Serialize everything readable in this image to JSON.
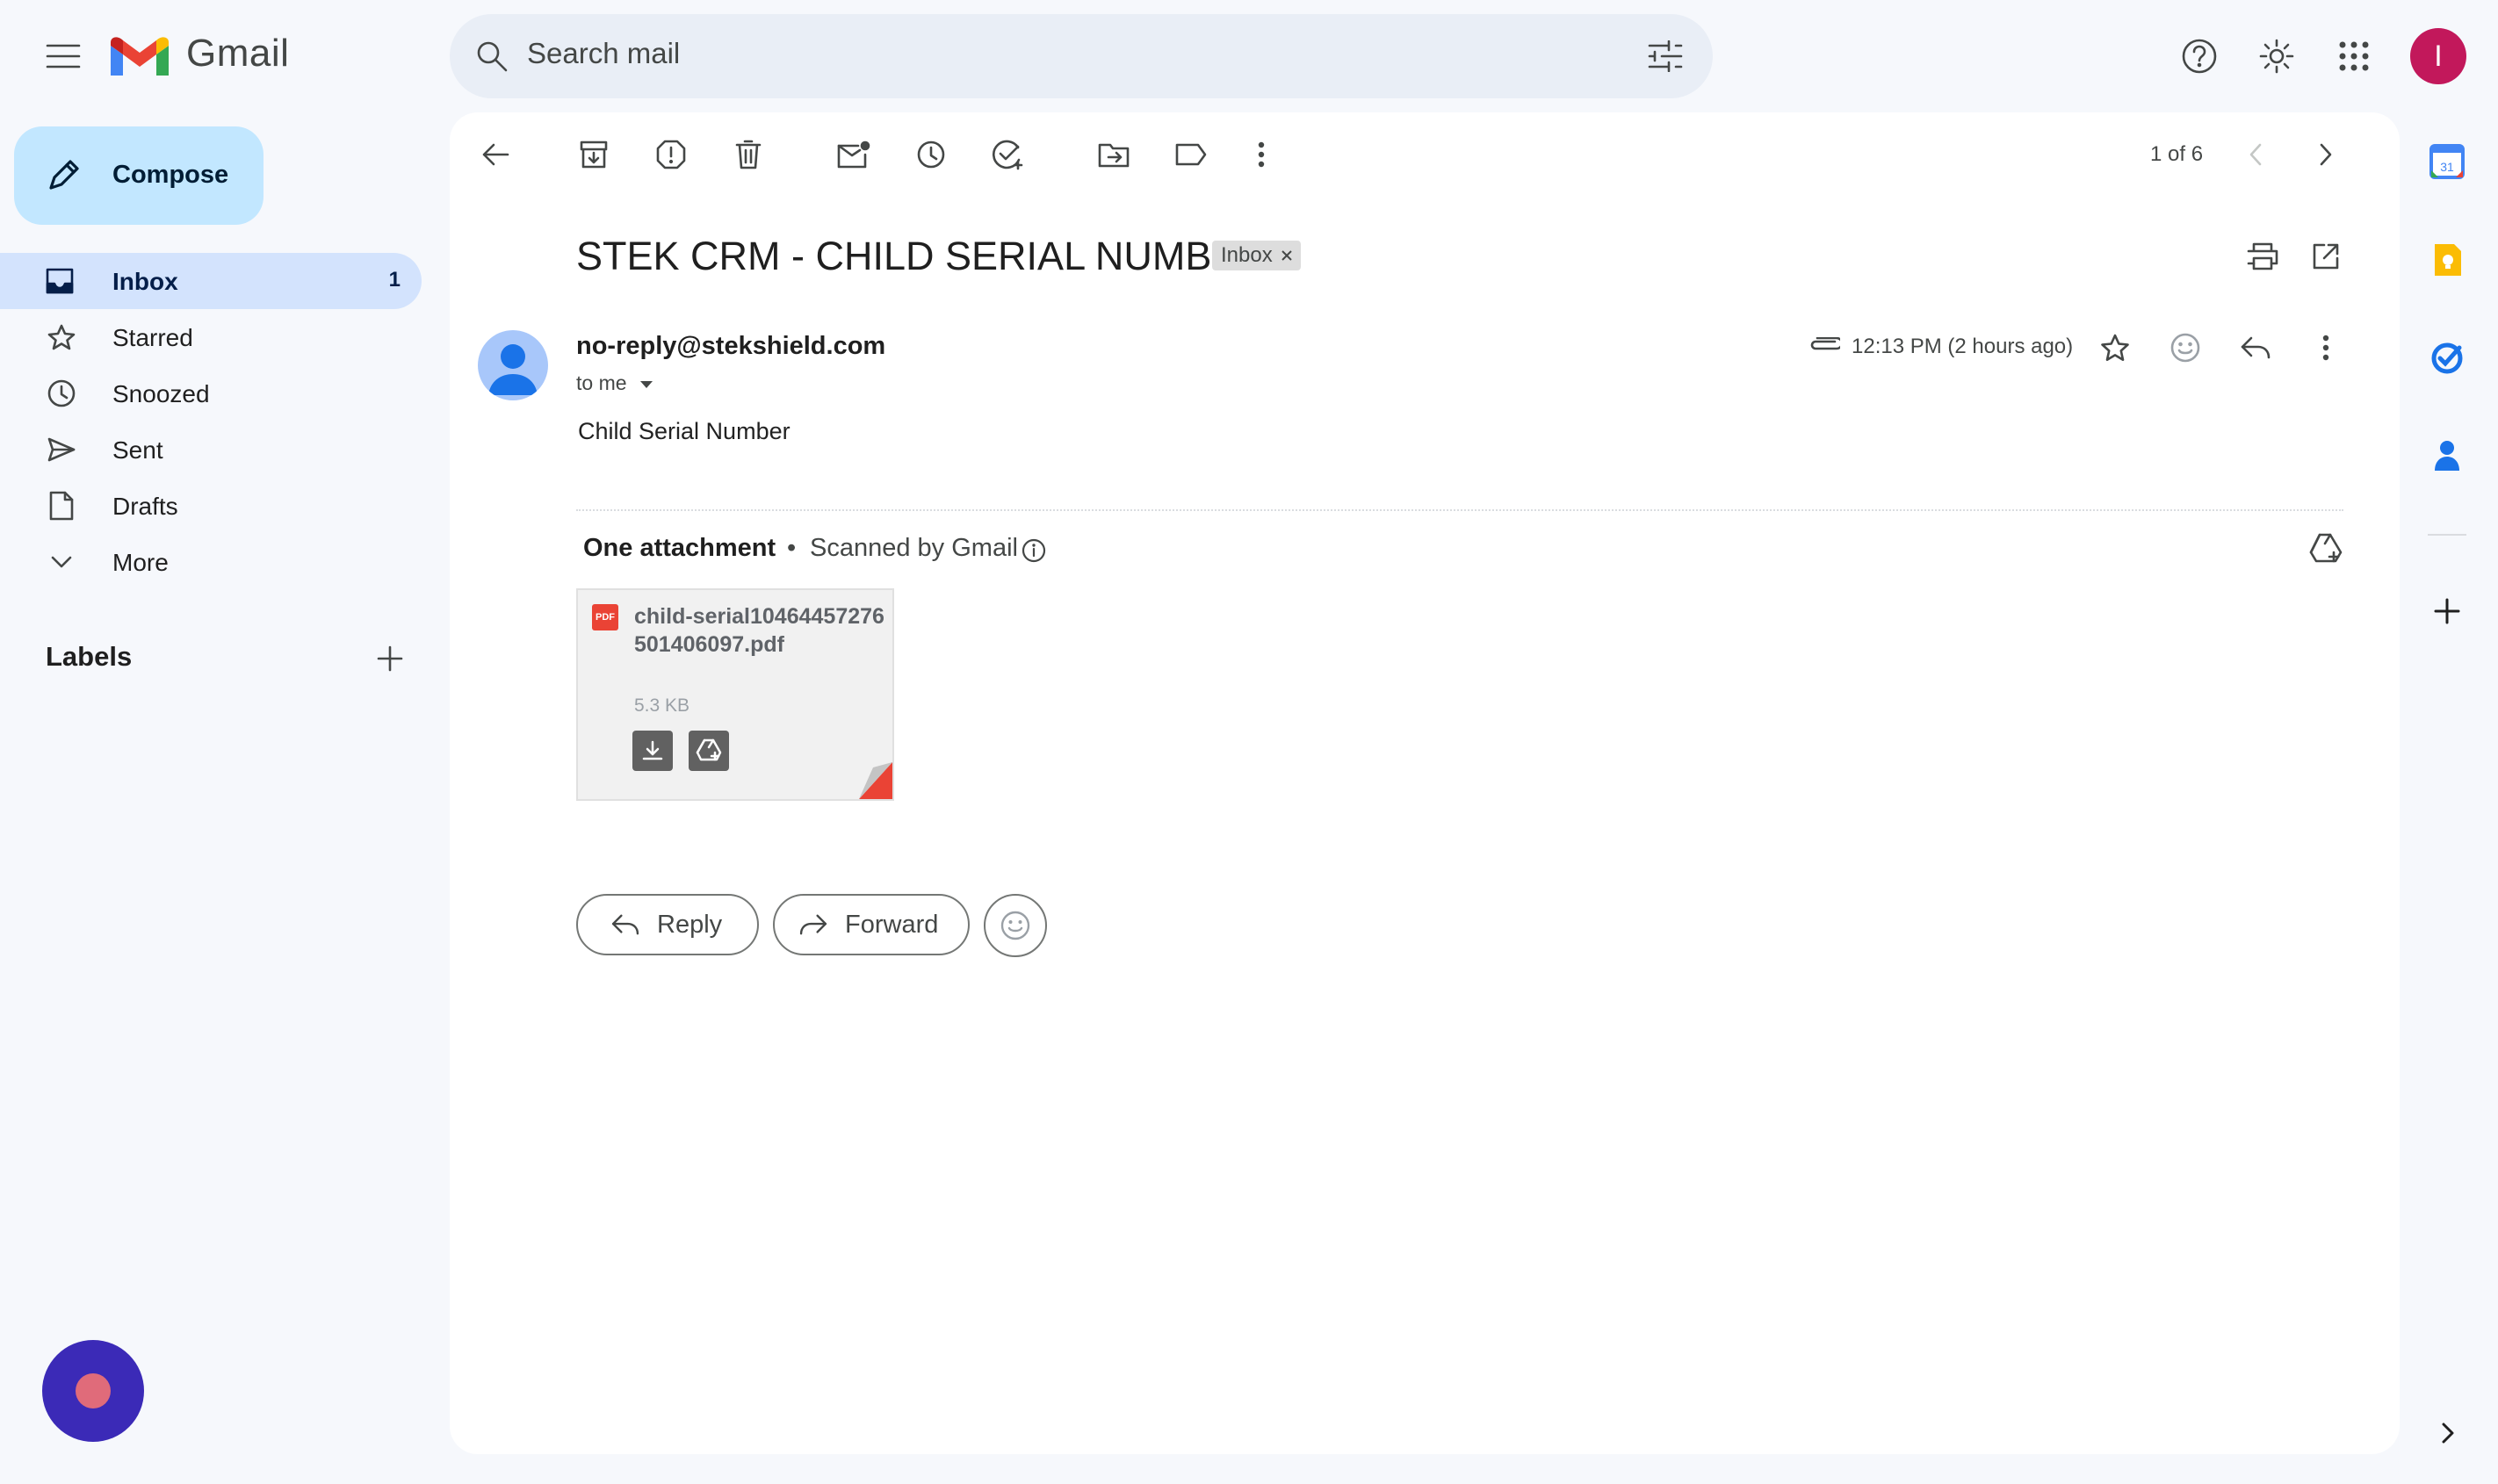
{
  "app": {
    "name": "Gmail",
    "account_initial": "I"
  },
  "search": {
    "placeholder": "Search mail"
  },
  "sidebar": {
    "compose_label": "Compose",
    "items": [
      {
        "label": "Inbox",
        "count": "1",
        "active": true,
        "icon": "inbox-icon"
      },
      {
        "label": "Starred",
        "count": "",
        "active": false,
        "icon": "star-icon"
      },
      {
        "label": "Snoozed",
        "count": "",
        "active": false,
        "icon": "clock-icon"
      },
      {
        "label": "Sent",
        "count": "",
        "active": false,
        "icon": "send-icon"
      },
      {
        "label": "Drafts",
        "count": "",
        "active": false,
        "icon": "draft-icon"
      },
      {
        "label": "More",
        "count": "",
        "active": false,
        "icon": "chevron-down-icon"
      }
    ],
    "labels_title": "Labels"
  },
  "toolbar": {
    "pager": "1 of 6"
  },
  "email": {
    "subject": "STEK CRM - CHILD SERIAL NUMBER",
    "label_chip": "Inbox",
    "sender": "no-reply@stekshield.com",
    "recipient": "to me",
    "time": "12:13 PM (2 hours ago)",
    "body": "Child Serial Number",
    "attachments_title": "One attachment",
    "separator": "•",
    "scanned": "Scanned by Gmail",
    "attachment": {
      "file_type": "PDF",
      "filename": "child-serial10464457276501406097.pdf",
      "size": "5.3 KB"
    },
    "reply_label": "Reply",
    "forward_label": "Forward"
  },
  "colors": {
    "accent": "#c2e7ff",
    "active_nav": "#d3e3fd",
    "avatar": "#c2185b",
    "pdf": "#ea4335"
  }
}
